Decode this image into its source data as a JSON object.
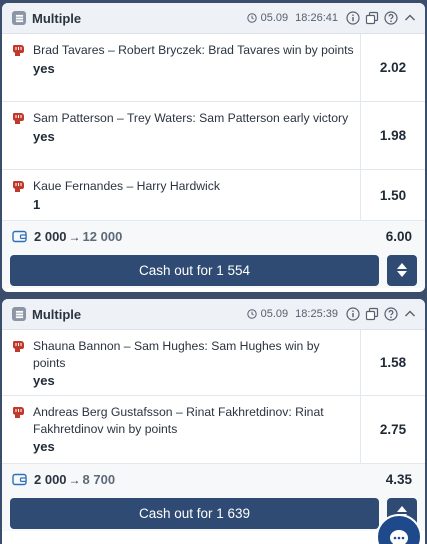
{
  "colors": {
    "accent": "#2f4b73",
    "background": "#3a4e6b",
    "fab": "#1e4a8c"
  },
  "bets": [
    {
      "type_icon": "multiple-icon",
      "title": "Multiple",
      "date": "05.09",
      "time": "18:26:41",
      "header_icons": [
        "info-icon",
        "copy-icon",
        "help-icon",
        "chevron-up-icon"
      ],
      "selections": [
        {
          "sport_icon": "mma-glove-icon",
          "event": "Brad Tavares – Robert Bryczek: Brad Tavares win by points",
          "pick": "yes",
          "odds": "2.02"
        },
        {
          "sport_icon": "mma-glove-icon",
          "event": "Sam Patterson – Trey Waters: Sam Patterson early victory",
          "pick": "yes",
          "odds": "1.98"
        },
        {
          "sport_icon": "mma-glove-icon",
          "event": "Kaue Fernandes – Harry Hardwick",
          "pick": "1",
          "odds": "1.50"
        }
      ],
      "stake": "2 000",
      "arrow": "→",
      "potential_win": "12 000",
      "total_odds": "6.00",
      "cashout_label": "Cash out for 1 554"
    },
    {
      "type_icon": "multiple-icon",
      "title": "Multiple",
      "date": "05.09",
      "time": "18:25:39",
      "header_icons": [
        "info-icon",
        "copy-icon",
        "help-icon",
        "chevron-up-icon"
      ],
      "selections": [
        {
          "sport_icon": "mma-glove-icon",
          "event": "Shauna Bannon – Sam Hughes: Sam Hughes win by points",
          "pick": "yes",
          "odds": "1.58"
        },
        {
          "sport_icon": "mma-glove-icon",
          "event": "Andreas Berg Gustafsson – Rinat Fakhretdinov: Rinat Fakhretdinov win by points",
          "pick": "yes",
          "odds": "2.75"
        }
      ],
      "stake": "2 000",
      "arrow": "→",
      "potential_win": "8 700",
      "total_odds": "4.35",
      "cashout_label": "Cash out for 1 639"
    }
  ],
  "fab_icon": "chat-icon"
}
